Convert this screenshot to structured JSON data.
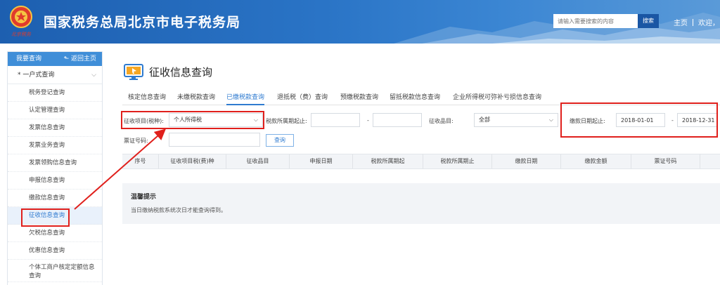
{
  "header": {
    "site_title": "国家税务总局北京市电子税务局",
    "search_placeholder": "请输入需要搜索的内容",
    "search_button": "搜索",
    "link_home": "主页",
    "link_welcome": "欢迎，",
    "emblem_text": "北京税务"
  },
  "sidebar": {
    "head_label": "我要查询",
    "back_label": "返回主页",
    "group_label": "一户式查询",
    "items": [
      {
        "label": "税务登记查询"
      },
      {
        "label": "认定管理查询"
      },
      {
        "label": "发票信息查询"
      },
      {
        "label": "发票业务查询"
      },
      {
        "label": "发票领购信息查询"
      },
      {
        "label": "申报信息查询"
      },
      {
        "label": "缴款信息查询"
      },
      {
        "label": "征收信息查询"
      },
      {
        "label": "欠税信息查询"
      },
      {
        "label": "优惠信息查询"
      },
      {
        "label": "个体工商户核定定额信息查询"
      }
    ]
  },
  "main": {
    "page_title": "征收信息查询",
    "tabs": [
      {
        "label": "核定信息查询"
      },
      {
        "label": "未缴税款查询"
      },
      {
        "label": "已缴税款查询"
      },
      {
        "label": "退抵税（费）查询"
      },
      {
        "label": "预缴税款查询"
      },
      {
        "label": "留抵税款信息查询"
      },
      {
        "label": "企业所得税可弥补亏损信息查询"
      }
    ],
    "filters": {
      "item_label": "征收项目(税种):",
      "item_value": "个人所得税",
      "period_label": "税款所属期起止:",
      "period_sep": "-",
      "subitem_label": "征收品目:",
      "subitem_value": "全部",
      "pay_date_label": "缴款日期起止:",
      "pay_date_start": "2018-01-01",
      "pay_date_sep": "-",
      "pay_date_end": "2018-12-31",
      "ticket_label": "票证号码:",
      "query_button": "查询"
    },
    "table_columns": [
      "序号",
      "征收项目税(费)种",
      "征收品目",
      "申报日期",
      "税款所属期起",
      "税款所属期止",
      "缴款日期",
      "缴款金额",
      "票证号码"
    ],
    "tips_title": "温馨提示",
    "tips_text": "当日缴纳税款系统次日才能查询得到。"
  },
  "colors": {
    "header_blue": "#2a74c6",
    "sidebar_head": "#3f8ed8",
    "accent": "#2f7bd0",
    "annotation_red": "#e0201c"
  }
}
